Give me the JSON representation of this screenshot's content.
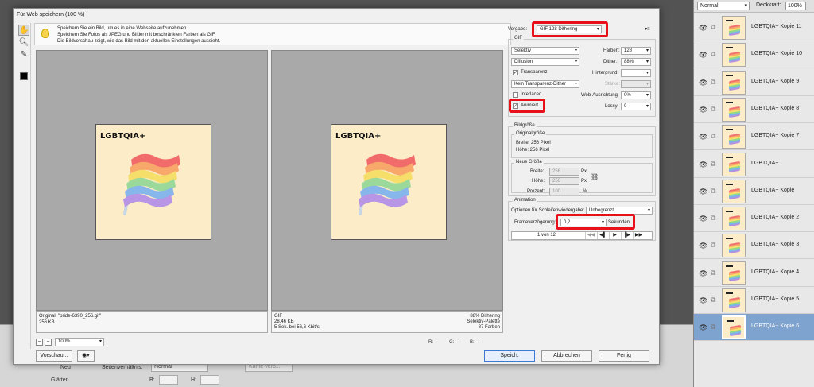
{
  "dialog": {
    "title": "Für Web speichern (100 %)",
    "info": [
      "Speichern Sie ein Bild, um es in eine Webseite aufzunehmen.",
      "Speichern Sie Fotos als JPEG und Bilder mit beschränkten Farben als GIF.",
      "Die Bildvorschau zeigt, wie das Bild mit den aktuellen Einstellungen aussieht."
    ],
    "image_title": "LGBTQIA+",
    "original": {
      "line1": "Original: \"pride-6390_256.gif\"",
      "line2": "256 KB"
    },
    "optimized": {
      "line1": "GIF",
      "line2": "28,46 KB",
      "line3": "5 Sek. bei 56,6 Kbit/s",
      "r1": "88% Dithering",
      "r2": "Selektiv-Palette",
      "r3": "87 Farben"
    },
    "zoom": "100%",
    "rgb": {
      "r": "R: --",
      "g": "G: --",
      "b": "B: --"
    },
    "buttons": {
      "preview": "Vorschau...",
      "save": "Speich.",
      "cancel": "Abbrechen",
      "done": "Fertig"
    },
    "settings": {
      "preset_label": "Vorgabe:",
      "preset": "GIF 128 Dithering",
      "gif_label": "GIF",
      "palette": "Selektiv",
      "colors_label": "Farben:",
      "colors": "128",
      "dither_algo": "Diffusion",
      "dither_label": "Dither:",
      "dither": "88%",
      "transparency_label": "Transparenz",
      "matte_label": "Hintergrund:",
      "trans_dither": "Kein Transparenz-Dither",
      "amount_label": "Stärke:",
      "interlaced_label": "Interlaced",
      "websnap_label": "Web-Ausrichtung:",
      "websnap": "0%",
      "animated_label": "Animiert",
      "lossy_label": "Lossy:",
      "lossy": "0",
      "image_size_label": "Bildgröße",
      "orig_size_label": "Originalgröße",
      "orig_width": "Breite:  256 Pixel",
      "orig_height": "Höhe:  256 Pixel",
      "new_size_label": "Neue Größe",
      "width_label": "Breite:",
      "width": "256",
      "height_label": "Höhe:",
      "height": "256",
      "px": "Px",
      "percent_label": "Prozent:",
      "percent": "100",
      "pct": "%",
      "animation_label": "Animation",
      "loop_label": "Optionen für Schleifenwiedergabe:",
      "loop": "Unbegrenzt",
      "delay_label": "Frameverzögerung:",
      "delay": "0,2",
      "seconds": "Sekunden",
      "frame_count": "1 von 12"
    }
  },
  "background": {
    "labels": [
      "Neu",
      "Glätten",
      "Seitenverhältnis:",
      "Normal",
      "B:",
      "H:",
      "Kante verb..."
    ]
  },
  "layers": {
    "mode": "Normal",
    "opacity_label": "Deckkraft:",
    "opacity": "100%",
    "items": [
      {
        "name": "LGBTQIA+ Kopie 11"
      },
      {
        "name": "LGBTQIA+ Kopie 10"
      },
      {
        "name": "LGBTQIA+ Kopie 9"
      },
      {
        "name": "LGBTQIA+ Kopie 8"
      },
      {
        "name": "LGBTQIA+ Kopie 7"
      },
      {
        "name": "LGBTQIA+"
      },
      {
        "name": "LGBTQIA+ Kopie"
      },
      {
        "name": "LGBTQIA+ Kopie 2"
      },
      {
        "name": "LGBTQIA+ Kopie 3"
      },
      {
        "name": "LGBTQIA+ Kopie 4"
      },
      {
        "name": "LGBTQIA+ Kopie 5"
      },
      {
        "name": "LGBTQIA+ Kopie 6"
      }
    ]
  },
  "colors": {
    "highlight": "#e8101a",
    "selected_layer": "#7fa3cf",
    "image_bg": "#fcecc8"
  }
}
